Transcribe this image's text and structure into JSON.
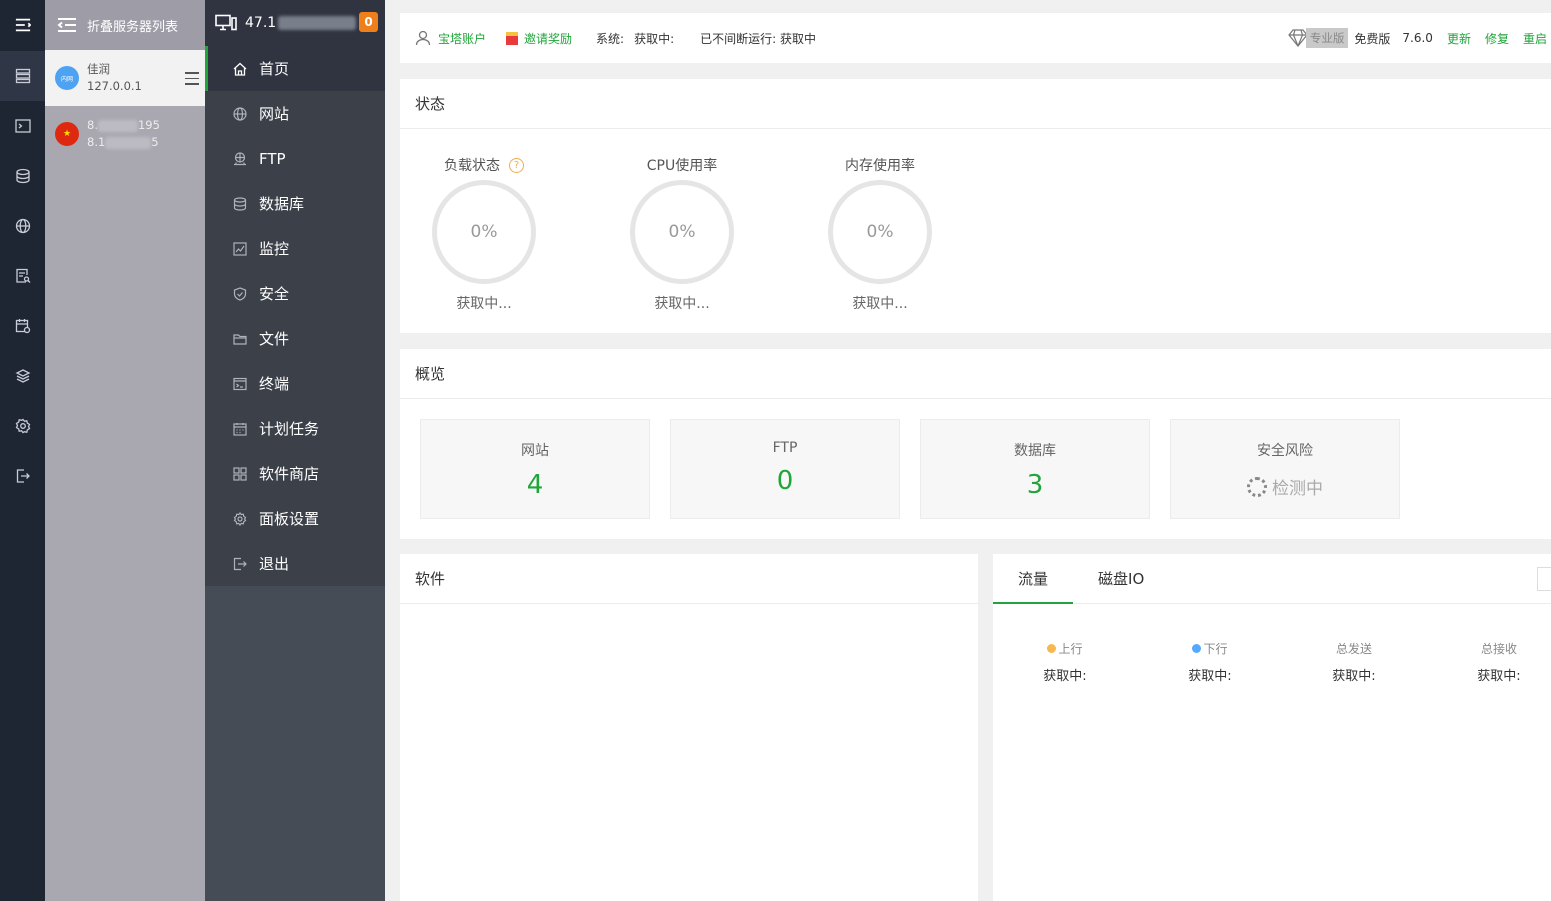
{
  "server_panel": {
    "title": "折叠服务器列表",
    "servers": [
      {
        "avatar_text": "内网",
        "name": "佳润",
        "ip": "127.0.0.1"
      },
      {
        "avatar_text": "★",
        "line1_start": "8.",
        "line1_end": "195",
        "line2_start": "8.1",
        "line2_end": "5"
      }
    ]
  },
  "nav": {
    "host_prefix": "47.1",
    "badge": "0",
    "items": [
      {
        "label": "首页",
        "icon": "home-icon"
      },
      {
        "label": "网站",
        "icon": "globe-icon"
      },
      {
        "label": "FTP",
        "icon": "ftp-icon"
      },
      {
        "label": "数据库",
        "icon": "database-icon"
      },
      {
        "label": "监控",
        "icon": "monitor-icon"
      },
      {
        "label": "安全",
        "icon": "shield-icon"
      },
      {
        "label": "文件",
        "icon": "folder-icon"
      },
      {
        "label": "终端",
        "icon": "terminal-icon"
      },
      {
        "label": "计划任务",
        "icon": "calendar-icon"
      },
      {
        "label": "软件商店",
        "icon": "grid-icon"
      },
      {
        "label": "面板设置",
        "icon": "gear-icon"
      },
      {
        "label": "退出",
        "icon": "logout-icon"
      }
    ]
  },
  "topbar": {
    "account": "宝塔账户",
    "invite": "邀请奖励",
    "system_label": "系统:",
    "system_value": "获取中:",
    "uptime": "已不间断运行: 获取中",
    "pro_badge": "专业版",
    "free_edition": "免费版",
    "version": "7.6.0",
    "update": "更新",
    "repair": "修复",
    "restart": "重启"
  },
  "status": {
    "title": "状态",
    "gauges": [
      {
        "label": "负载状态",
        "value": "0%",
        "sub": "获取中..."
      },
      {
        "label": "CPU使用率",
        "value": "0%",
        "sub": "获取中..."
      },
      {
        "label": "内存使用率",
        "value": "0%",
        "sub": "获取中..."
      }
    ]
  },
  "overview": {
    "title": "概览",
    "boxes": [
      {
        "name": "网站",
        "value": "4"
      },
      {
        "name": "FTP",
        "value": "0"
      },
      {
        "name": "数据库",
        "value": "3"
      },
      {
        "name": "安全风险",
        "value": "检测中"
      }
    ]
  },
  "software": {
    "title": "软件"
  },
  "traffic": {
    "tabs": [
      "流量",
      "磁盘IO"
    ],
    "stats": [
      {
        "label": "上行",
        "value": "获取中:",
        "dot_color": "#f7b851"
      },
      {
        "label": "下行",
        "value": "获取中:",
        "dot_color": "#52a9ff"
      },
      {
        "label": "总发送",
        "value": "获取中:"
      },
      {
        "label": "总接收",
        "value": "获取中:"
      }
    ]
  },
  "colors": {
    "accent": "#20a53a",
    "badge": "#ef7f1a"
  }
}
